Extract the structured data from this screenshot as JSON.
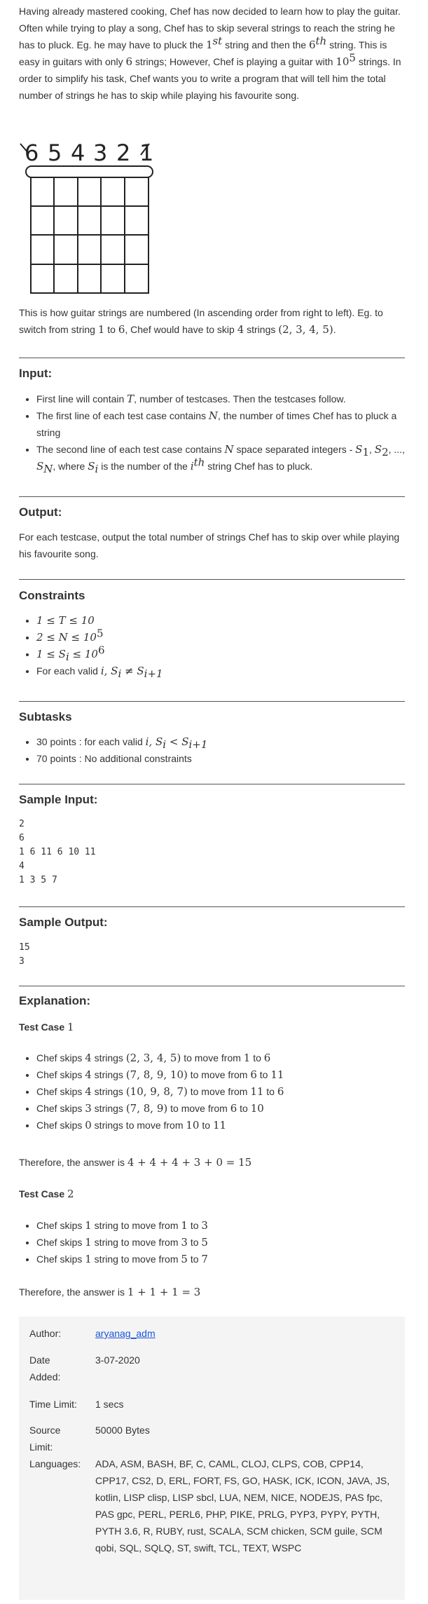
{
  "intro": {
    "p1": "Having already mastered cooking, Chef has now decided to learn how to play the guitar. Often while trying to play a song, Chef has to skip several strings to reach the string he has to pluck. Eg. he may have to pluck the ",
    "p1_s1": "1",
    "p1_st": "st",
    "p1_mid": " string and then the ",
    "p1_s6": "6",
    "p1_th": "th",
    "p1_b": " string. This is easy in guitars with only ",
    "p1_six": "6",
    "p1_c": " strings; However, Chef is playing a guitar with ",
    "p1_ten": "10",
    "p1_five": "5",
    "p1_d": " strings. In order to simplify his task, Chef wants you to write a program that will tell him the total number of strings he has to skip while playing his favourite song."
  },
  "figure": {
    "numbers": [
      "6",
      "5",
      "4",
      "3",
      "2",
      "1"
    ]
  },
  "after_fig": {
    "a": "This is how guitar strings are numbered (In ascending order from right to left). Eg. to switch from string ",
    "one": "1",
    "b": " to ",
    "six": "6",
    "c": ", Chef would have to skip ",
    "four": "4",
    "d": " strings ",
    "set": "(2, 3, 4, 5)",
    "e": "."
  },
  "input": {
    "heading": "Input:",
    "l1a": "First line will contain ",
    "l1T": "T",
    "l1b": ", number of testcases. Then the testcases follow.",
    "l2a": "The first line of each test case contains ",
    "l2N": "N",
    "l2b": ", the number of times Chef has to pluck a string",
    "l3a": "The second line of each test case contains ",
    "l3N": "N",
    "l3b": " space separated integers - ",
    "l3S1": "S",
    "l3S1s": "1",
    "l3c": ", ",
    "l3S2": "S",
    "l3S2s": "2",
    "l3d": ", ..., ",
    "l3SN": "S",
    "l3SNs": "N",
    "l3e": ", where ",
    "l3Si": "S",
    "l3Sis": "i",
    "l3f": " is the number of the ",
    "l3i": "i",
    "l3th": "th",
    "l3g": " string Chef has to pluck."
  },
  "output": {
    "heading": "Output:",
    "text": "For each testcase, output the total number of strings Chef has to skip over while playing his favourite song."
  },
  "constraints": {
    "heading": "Constraints",
    "c1": "1 ≤ T ≤ 10",
    "c2a": "2 ≤ N ≤ 10",
    "c2b": "5",
    "c3a": "1 ≤ S",
    "c3s": "i",
    "c3b": " ≤ 10",
    "c3c": "6",
    "c4a": "For each valid ",
    "c4i": "i",
    "c4b": ", S",
    "c4s": "i",
    "c4c": " ≠ S",
    "c4d": "i+1"
  },
  "subtasks": {
    "heading": "Subtasks",
    "s1a": "30 points : for each valid ",
    "s1i": "i",
    "s1b": ", S",
    "s1s": "i",
    "s1c": " < S",
    "s1d": "i+1",
    "s2": "70 points : No additional constraints"
  },
  "sample_input": {
    "heading": "Sample Input:",
    "lines": [
      "2",
      "6",
      "1 6 11 6 10 11",
      "4",
      "1 3 5 7"
    ]
  },
  "sample_output": {
    "heading": "Sample Output:",
    "lines": [
      "15",
      "3"
    ]
  },
  "explanation": {
    "heading": "Explanation:",
    "tc1": "Test Case",
    "tc1n": "1",
    "tc1_items": [
      {
        "a": "Chef skips ",
        "n": "4",
        "b": " strings ",
        "set": "(2, 3, 4, 5)",
        "c": " to move from ",
        "f": "1",
        "d": " to ",
        "t": "6"
      },
      {
        "a": "Chef skips ",
        "n": "4",
        "b": " strings ",
        "set": "(7, 8, 9, 10)",
        "c": " to move from ",
        "f": "6",
        "d": " to ",
        "t": "11"
      },
      {
        "a": "Chef skips ",
        "n": "4",
        "b": " strings ",
        "set": "(10, 9, 8, 7)",
        "c": " to move from ",
        "f": "11",
        "d": " to ",
        "t": "6"
      },
      {
        "a": "Chef skips ",
        "n": "3",
        "b": " strings ",
        "set": "(7, 8, 9)",
        "c": " to move from ",
        "f": "6",
        "d": " to ",
        "t": "10"
      },
      {
        "a": "Chef skips ",
        "n": "0",
        "b": " strings to move from ",
        "set": "",
        "c": "",
        "f": "10",
        "d": " to ",
        "t": "11"
      }
    ],
    "tc1_ans_a": "Therefore, the answer is ",
    "tc1_ans": "4 + 4 + 4 + 3 + 0 = 15",
    "tc2": "Test Case",
    "tc2n": "2",
    "tc2_items": [
      {
        "a": "Chef skips ",
        "n": "1",
        "b": " string to move from ",
        "f": "1",
        "d": " to ",
        "t": "3"
      },
      {
        "a": "Chef skips ",
        "n": "1",
        "b": " string to move from ",
        "f": "3",
        "d": " to ",
        "t": "5"
      },
      {
        "a": "Chef skips ",
        "n": "1",
        "b": " string to move from ",
        "f": "5",
        "d": " to ",
        "t": "7"
      }
    ],
    "tc2_ans_a": "Therefore, the answer is ",
    "tc2_ans": "1 + 1 + 1 = 3"
  },
  "meta": {
    "author_label": "Author:",
    "author": "aryanag_adm",
    "date_label": "Date Added:",
    "date": "3-07-2020",
    "time_label": "Time Limit:",
    "time": "1 secs",
    "source_label": "Source Limit:",
    "source": "50000 Bytes",
    "lang_label": "Languages:",
    "languages": "ADA, ASM, BASH, BF, C, CAML, CLOJ, CLPS, COB, CPP14, CPP17, CS2, D, ERL, FORT, FS, GO, HASK, ICK, ICON, JAVA, JS, kotlin, LISP clisp, LISP sbcl, LUA, NEM, NICE, NODEJS, PAS fpc, PAS gpc, PERL, PERL6, PHP, PIKE, PRLG, PYP3, PYPY, PYTH, PYTH 3.6, R, RUBY, rust, SCALA, SCM chicken, SCM guile, SCM qobi, SQL, SQLQ, ST, swift, TCL, TEXT, WSPC"
  }
}
